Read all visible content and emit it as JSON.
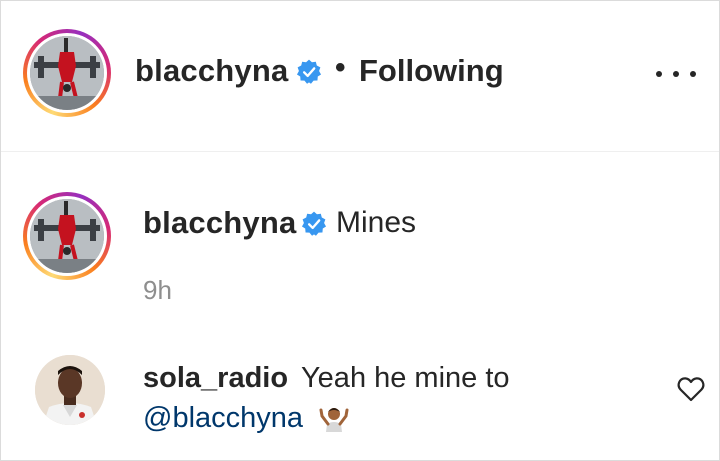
{
  "header": {
    "username": "blacchyna",
    "verified_icon": "verified-badge-icon",
    "separator": "•",
    "follow_status": "Following",
    "more_icon": "more-options-icon"
  },
  "caption": {
    "username": "blacchyna",
    "verified_icon": "verified-badge-icon",
    "text": "Mines",
    "time": "9h"
  },
  "comment": {
    "username": "sola_radio",
    "text": "Yeah he mine to",
    "mention": "@blacchyna",
    "emoji_icon": "person-shrugging-emoji",
    "like_icon": "heart-outline-icon"
  },
  "colors": {
    "text_primary": "#262626",
    "text_secondary": "#8e8e8e",
    "verified_blue": "#3897f0",
    "mention_link": "#00376b",
    "divider": "#efefef"
  }
}
